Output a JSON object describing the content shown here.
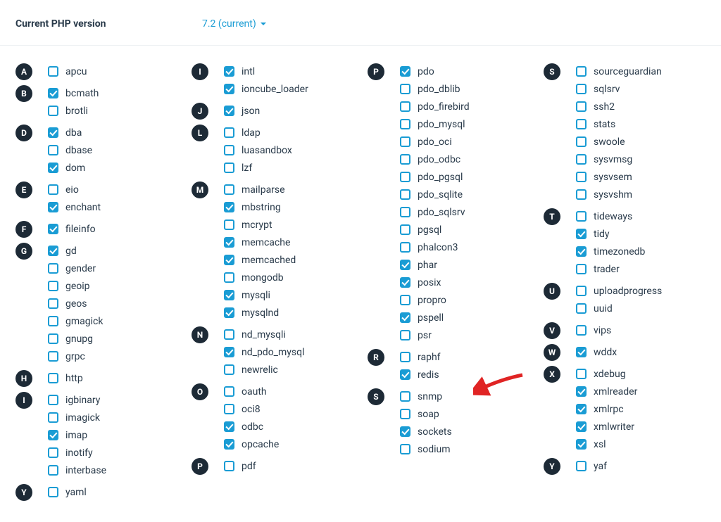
{
  "header": {
    "label": "Current PHP version",
    "value": "7.2 (current)"
  },
  "columns": [
    [
      {
        "letter": "A",
        "items": [
          {
            "label": "apcu",
            "checked": false
          }
        ]
      },
      {
        "letter": "B",
        "items": [
          {
            "label": "bcmath",
            "checked": true
          },
          {
            "label": "brotli",
            "checked": false
          }
        ]
      },
      {
        "letter": "D",
        "items": [
          {
            "label": "dba",
            "checked": true
          },
          {
            "label": "dbase",
            "checked": false
          },
          {
            "label": "dom",
            "checked": true
          }
        ]
      },
      {
        "letter": "E",
        "items": [
          {
            "label": "eio",
            "checked": false
          },
          {
            "label": "enchant",
            "checked": true
          }
        ]
      },
      {
        "letter": "F",
        "items": [
          {
            "label": "fileinfo",
            "checked": true
          }
        ]
      },
      {
        "letter": "G",
        "items": [
          {
            "label": "gd",
            "checked": true
          },
          {
            "label": "gender",
            "checked": false
          },
          {
            "label": "geoip",
            "checked": false
          },
          {
            "label": "geos",
            "checked": false
          },
          {
            "label": "gmagick",
            "checked": false
          },
          {
            "label": "gnupg",
            "checked": false
          },
          {
            "label": "grpc",
            "checked": false
          }
        ]
      },
      {
        "letter": "H",
        "items": [
          {
            "label": "http",
            "checked": false
          }
        ]
      },
      {
        "letter": "I",
        "items": [
          {
            "label": "igbinary",
            "checked": false
          },
          {
            "label": "imagick",
            "checked": false
          },
          {
            "label": "imap",
            "checked": true
          },
          {
            "label": "inotify",
            "checked": false
          },
          {
            "label": "interbase",
            "checked": false
          }
        ]
      },
      {
        "letter": "Y",
        "items": [
          {
            "label": "yaml",
            "checked": false
          }
        ]
      }
    ],
    [
      {
        "letter": "I",
        "items": [
          {
            "label": "intl",
            "checked": true
          },
          {
            "label": "ioncube_loader",
            "checked": true
          }
        ]
      },
      {
        "letter": "J",
        "items": [
          {
            "label": "json",
            "checked": true
          }
        ]
      },
      {
        "letter": "L",
        "items": [
          {
            "label": "ldap",
            "checked": false
          },
          {
            "label": "luasandbox",
            "checked": false
          },
          {
            "label": "lzf",
            "checked": false
          }
        ]
      },
      {
        "letter": "M",
        "items": [
          {
            "label": "mailparse",
            "checked": false
          },
          {
            "label": "mbstring",
            "checked": true
          },
          {
            "label": "mcrypt",
            "checked": false
          },
          {
            "label": "memcache",
            "checked": true
          },
          {
            "label": "memcached",
            "checked": true
          },
          {
            "label": "mongodb",
            "checked": false
          },
          {
            "label": "mysqli",
            "checked": true
          },
          {
            "label": "mysqlnd",
            "checked": true
          }
        ]
      },
      {
        "letter": "N",
        "items": [
          {
            "label": "nd_mysqli",
            "checked": false
          },
          {
            "label": "nd_pdo_mysql",
            "checked": true
          },
          {
            "label": "newrelic",
            "checked": false
          }
        ]
      },
      {
        "letter": "O",
        "items": [
          {
            "label": "oauth",
            "checked": false
          },
          {
            "label": "oci8",
            "checked": false
          },
          {
            "label": "odbc",
            "checked": true
          },
          {
            "label": "opcache",
            "checked": true
          }
        ]
      },
      {
        "letter": "P",
        "items": [
          {
            "label": "pdf",
            "checked": false
          }
        ]
      }
    ],
    [
      {
        "letter": "P",
        "items": [
          {
            "label": "pdo",
            "checked": true
          },
          {
            "label": "pdo_dblib",
            "checked": false
          },
          {
            "label": "pdo_firebird",
            "checked": false
          },
          {
            "label": "pdo_mysql",
            "checked": false
          },
          {
            "label": "pdo_oci",
            "checked": false
          },
          {
            "label": "pdo_odbc",
            "checked": false
          },
          {
            "label": "pdo_pgsql",
            "checked": false
          },
          {
            "label": "pdo_sqlite",
            "checked": false
          },
          {
            "label": "pdo_sqlsrv",
            "checked": false
          },
          {
            "label": "pgsql",
            "checked": false
          },
          {
            "label": "phalcon3",
            "checked": false
          },
          {
            "label": "phar",
            "checked": true
          },
          {
            "label": "posix",
            "checked": true
          },
          {
            "label": "propro",
            "checked": false
          },
          {
            "label": "pspell",
            "checked": true
          },
          {
            "label": "psr",
            "checked": false
          }
        ]
      },
      {
        "letter": "R",
        "items": [
          {
            "label": "raphf",
            "checked": false
          },
          {
            "label": "redis",
            "checked": true
          }
        ]
      },
      {
        "letter": "S",
        "items": [
          {
            "label": "snmp",
            "checked": false
          },
          {
            "label": "soap",
            "checked": false
          },
          {
            "label": "sockets",
            "checked": true
          },
          {
            "label": "sodium",
            "checked": false
          }
        ]
      }
    ],
    [
      {
        "letter": "S",
        "items": [
          {
            "label": "sourceguardian",
            "checked": false
          },
          {
            "label": "sqlsrv",
            "checked": false
          },
          {
            "label": "ssh2",
            "checked": false
          },
          {
            "label": "stats",
            "checked": false
          },
          {
            "label": "swoole",
            "checked": false
          },
          {
            "label": "sysvmsg",
            "checked": false
          },
          {
            "label": "sysvsem",
            "checked": false
          },
          {
            "label": "sysvshm",
            "checked": false
          }
        ]
      },
      {
        "letter": "T",
        "items": [
          {
            "label": "tideways",
            "checked": false
          },
          {
            "label": "tidy",
            "checked": true
          },
          {
            "label": "timezonedb",
            "checked": true
          },
          {
            "label": "trader",
            "checked": false
          }
        ]
      },
      {
        "letter": "U",
        "items": [
          {
            "label": "uploadprogress",
            "checked": false
          },
          {
            "label": "uuid",
            "checked": false
          }
        ]
      },
      {
        "letter": "V",
        "items": [
          {
            "label": "vips",
            "checked": false
          }
        ]
      },
      {
        "letter": "W",
        "items": [
          {
            "label": "wddx",
            "checked": true
          }
        ]
      },
      {
        "letter": "X",
        "items": [
          {
            "label": "xdebug",
            "checked": false
          },
          {
            "label": "xmlreader",
            "checked": true
          },
          {
            "label": "xmlrpc",
            "checked": true
          },
          {
            "label": "xmlwriter",
            "checked": true
          },
          {
            "label": "xsl",
            "checked": true
          }
        ]
      },
      {
        "letter": "Y",
        "items": [
          {
            "label": "yaf",
            "checked": false
          }
        ]
      }
    ]
  ]
}
